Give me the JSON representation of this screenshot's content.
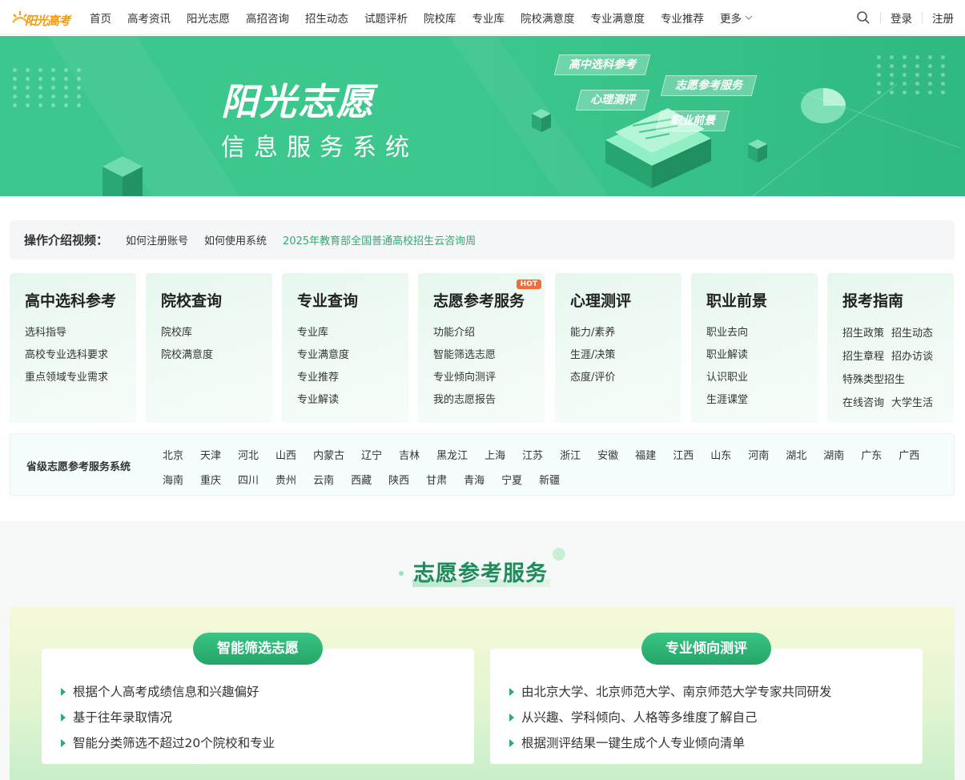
{
  "nav": {
    "logo_text": "阳光高考",
    "items": [
      "首页",
      "高考资讯",
      "阳光志愿",
      "高招咨询",
      "招生动态",
      "试题评析",
      "院校库",
      "专业库",
      "院校满意度",
      "专业满意度",
      "专业推荐"
    ],
    "more_label": "更多",
    "login": "登录",
    "register": "注册"
  },
  "banner": {
    "title": "阳光志愿",
    "subtitle": "信息服务系统",
    "tags": [
      "高中选科参考",
      "志愿参考服务",
      "心理测评",
      "职业前景"
    ]
  },
  "tutorial": {
    "label": "操作介绍视频：",
    "links": [
      "如何注册账号",
      "如何使用系统",
      "2025年教育部全国普通高校招生云咨询周"
    ]
  },
  "cards": [
    {
      "title": "高中选科参考",
      "links": [
        "选科指导",
        "高校专业选科要求",
        "重点领域专业需求"
      ]
    },
    {
      "title": "院校查询",
      "links": [
        "院校库",
        "院校满意度"
      ]
    },
    {
      "title": "专业查询",
      "links": [
        "专业库",
        "专业满意度",
        "专业推荐",
        "专业解读"
      ]
    },
    {
      "title": "志愿参考服务",
      "badge": "HOT",
      "links": [
        "功能介绍",
        "智能筛选志愿",
        "专业倾向测评",
        "我的志愿报告"
      ]
    },
    {
      "title": "心理测评",
      "links": [
        "能力/素养",
        "生涯/决策",
        "态度/评价"
      ]
    },
    {
      "title": "职业前景",
      "links": [
        "职业去向",
        "职业解读",
        "认识职业",
        "生涯课堂"
      ]
    },
    {
      "title": "报考指南",
      "pairs": [
        [
          "招生政策",
          "招生动态"
        ],
        [
          "招生章程",
          "招办访谈"
        ],
        [
          "特殊类型招生"
        ],
        [
          "在线咨询",
          "大学生活"
        ]
      ]
    }
  ],
  "provinces": {
    "label": "省级志愿参考服务系统",
    "list": [
      "北京",
      "天津",
      "河北",
      "山西",
      "内蒙古",
      "辽宁",
      "吉林",
      "黑龙江",
      "上海",
      "江苏",
      "浙江",
      "安徽",
      "福建",
      "江西",
      "山东",
      "河南",
      "湖北",
      "湖南",
      "广东",
      "广西",
      "海南",
      "重庆",
      "四川",
      "贵州",
      "云南",
      "西藏",
      "陕西",
      "甘肃",
      "青海",
      "宁夏",
      "新疆"
    ]
  },
  "section": {
    "title": "志愿参考服务",
    "features": [
      {
        "badge": "智能筛选志愿",
        "items": [
          "根据个人高考成绩信息和兴趣偏好",
          "基于往年录取情况",
          "智能分类筛选不超过20个院校和专业"
        ]
      },
      {
        "badge": "专业倾向测评",
        "items": [
          "由北京大学、北京师范大学、南京师范大学专家共同研发",
          "从兴趣、学科倾向、人格等多维度了解自己",
          "根据测评结果一键生成个人专业倾向清单"
        ]
      }
    ]
  },
  "colors": {
    "primary_green": "#3cc78c",
    "link_green": "#2eaa72",
    "hot_orange": "#f26b3a",
    "logo_orange": "#f29b11"
  }
}
